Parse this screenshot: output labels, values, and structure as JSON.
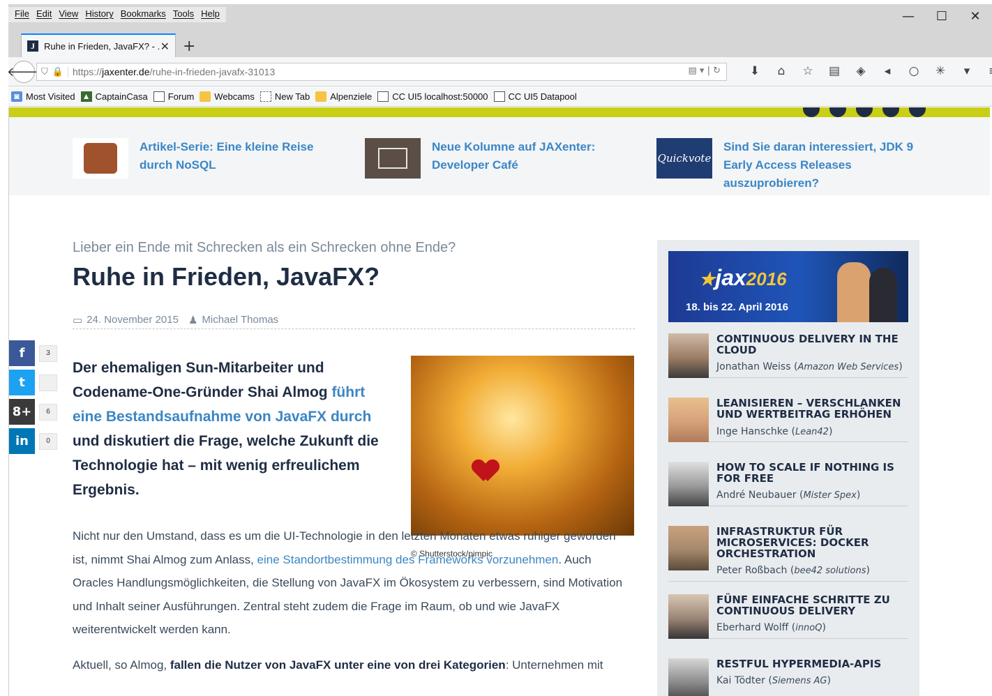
{
  "menu": [
    "File",
    "Edit",
    "View",
    "History",
    "Bookmarks",
    "Tools",
    "Help"
  ],
  "window_controls": {
    "minimize": "—",
    "maximize": "☐",
    "close": "✕"
  },
  "tab": {
    "title": "Ruhe in Frieden, JavaFX? - ...",
    "favicon": "J",
    "close": "✕",
    "new_tab": "+"
  },
  "url": {
    "scheme_prefix": "https://",
    "domain": "jaxenter.de",
    "path": "/ruhe-in-frieden-javafx-31013"
  },
  "bookmarks": [
    "Most Visited",
    "CaptainCasa",
    "Forum",
    "Webcams",
    "New Tab",
    "Alpenziele",
    "CC UI5 localhost:50000",
    "CC UI5 Datapool"
  ],
  "teasers": [
    {
      "text": "Artikel-Serie: Eine kleine Reise durch NoSQL"
    },
    {
      "text": "Neue Kolumne auf JAXenter: Developer Café"
    },
    {
      "text": "Sind Sie daran interessiert, JDK 9 Early Access Releases auszuprobieren?",
      "thumb_label": "Quickvote"
    }
  ],
  "article": {
    "kicker": "Lieber ein Ende mit Schrecken als ein Schrecken ohne Ende?",
    "title": "Ruhe in Frieden, JavaFX?",
    "date": "24. November 2015",
    "author": "Michael Thomas",
    "lead_1": "Der ehemaligen Sun-Mitarbeiter und Codename-One-Gründer Shai Almog ",
    "lead_link": "führt eine Bestandsaufnahme von JavaFX durch",
    "lead_2": " und diskutiert die Frage, welche Zukunft die Technologie hat – mit wenig erfreulichem Ergebnis.",
    "caption": "© Shutterstock/pimpic",
    "p1_1": "Nicht nur den Umstand, dass es um die UI-Technologie in den letzten Monaten etwas ruhiger geworden ist, nimmt Shai Almog zum Anlass, ",
    "p1_link": "eine Standortbestimmung des Frameworks vorzunehmen",
    "p1_2": ". Auch Oracles Handlungsmöglichkeiten, die Stellung von JavaFX im Ökosystem zu verbessern, sind Motivation und Inhalt seiner Ausführungen. Zentral steht zudem die Frage im Raum, ob und wie JavaFX weiterentwickelt werden kann.",
    "p2_1": "Aktuell, so Almog, ",
    "p2_bold": "fallen die Nutzer von JavaFX unter eine von drei Kategorien",
    "p2_2": ": Unternehmen mit"
  },
  "social": [
    {
      "icon": "f",
      "count": "3"
    },
    {
      "icon": "t",
      "count": ""
    },
    {
      "icon": "8+",
      "count": "6"
    },
    {
      "icon": "in",
      "count": "0"
    }
  ],
  "sidebar": {
    "banner_logo": "jax",
    "banner_year": "2016",
    "banner_dates": "18. bis 22. April 2016",
    "talks": [
      {
        "title": "CONTINUOUS DELIVERY IN THE CLOUD",
        "speaker": "Jonathan Weiss",
        "company": "Amazon Web Services"
      },
      {
        "title": "LEANISIEREN – VERSCHLANKEN UND WERTBEITRAG ERHÖHEN",
        "speaker": "Inge Hanschke",
        "company": "Lean42"
      },
      {
        "title": "HOW TO SCALE IF NOTHING IS FOR FREE",
        "speaker": "André Neubauer",
        "company": "Mister Spex"
      },
      {
        "title": "INFRASTRUKTUR FÜR MICROSERVICES: DOCKER ORCHESTRATION",
        "speaker": "Peter Roßbach",
        "company": "bee42 solutions"
      },
      {
        "title": "FÜNF EINFACHE SCHRITTE ZU CONTINUOUS DELIVERY",
        "speaker": "Eberhard Wolff",
        "company": "innoQ"
      },
      {
        "title": "RESTFUL HYPERMEDIA-APIS",
        "speaker": "Kai Tödter",
        "company": "Siemens AG"
      }
    ]
  }
}
